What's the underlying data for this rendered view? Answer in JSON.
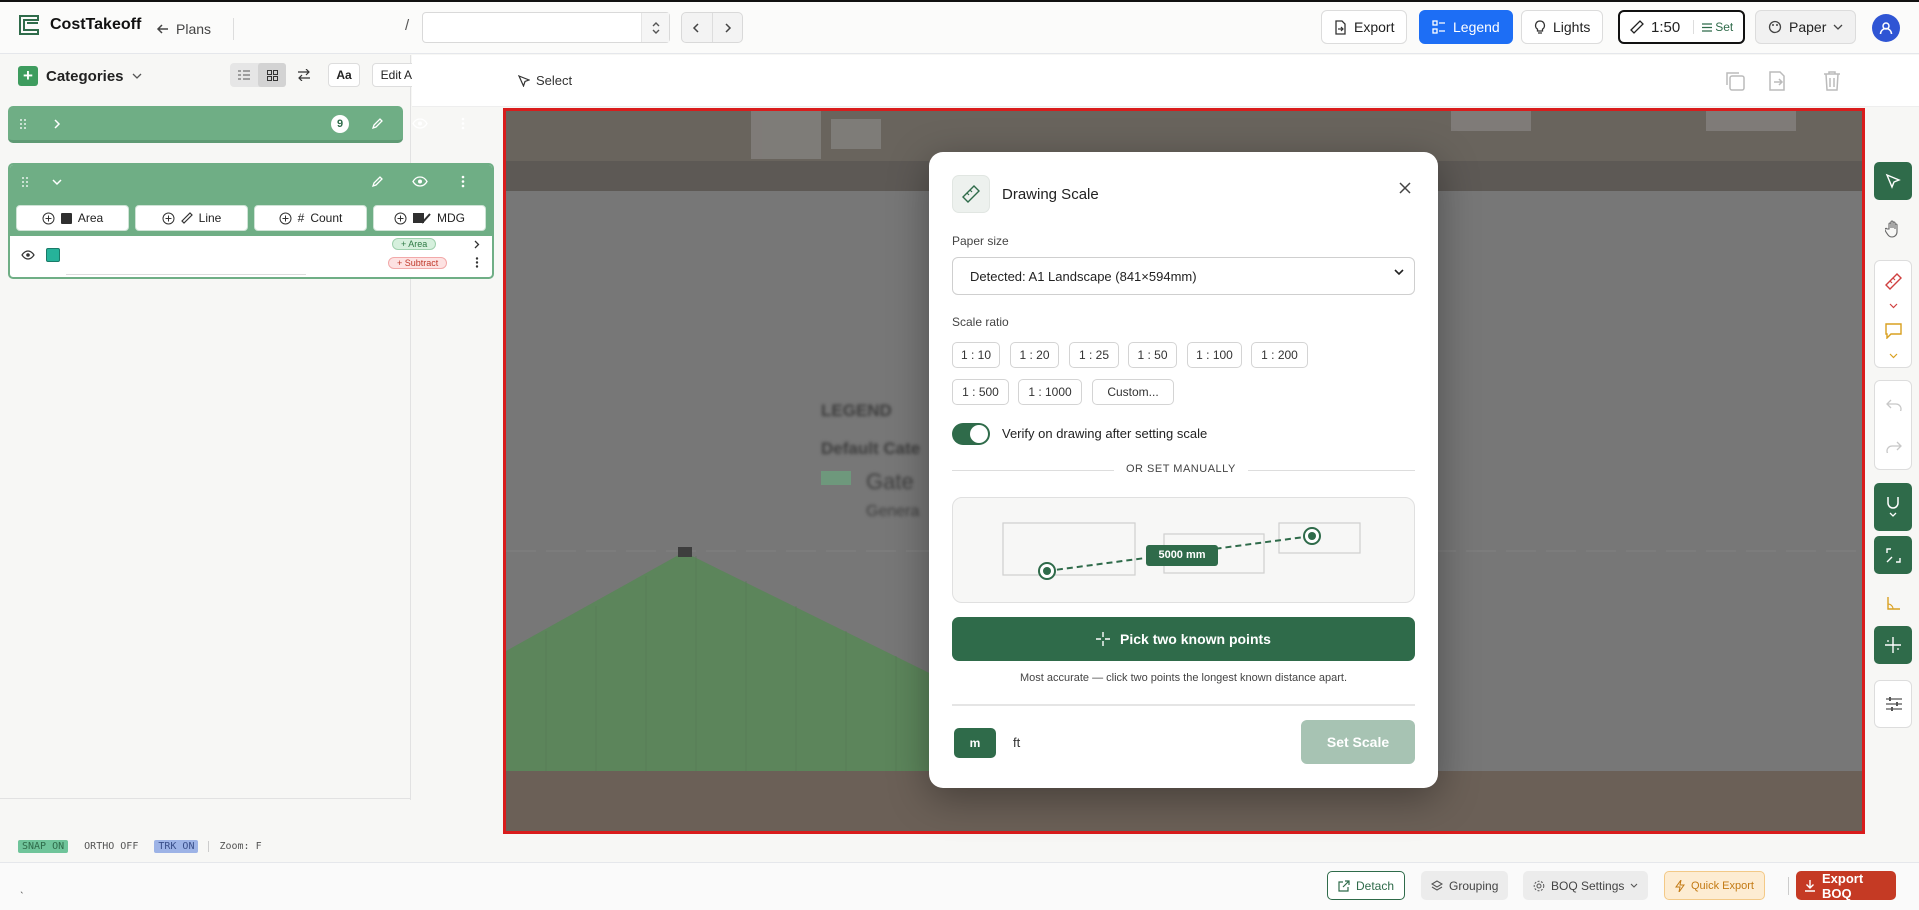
{
  "app": {
    "name": "CostTakeoff",
    "plans_label": "Plans",
    "breadcrumb_sep": "/",
    "plan_select_value": ""
  },
  "toolbar": {
    "export_label": "Export",
    "legend_label": "Legend",
    "lights_label": "Lights",
    "scale_value": "1:50",
    "scale_set_label": "Set",
    "paper_label": "Paper"
  },
  "sidebar": {
    "title": "Categories",
    "text_size_label": "Aa",
    "edit_all_label": "Edit All",
    "group_count": "9",
    "add_buttons": [
      "Area",
      "Line",
      "Count",
      "MDG"
    ],
    "item_area_pill": "+ Area",
    "item_subtract_pill": "+ Subtract"
  },
  "canvas": {
    "select_label": "Select",
    "legend_heading": "LEGEND",
    "legend_line2": "Default Cate",
    "legend_line3": "Gate",
    "legend_line4": "Genera"
  },
  "modal": {
    "title": "Drawing Scale",
    "paper_size_label": "Paper size",
    "paper_size_value": "Detected: A1 Landscape (841×594mm)",
    "scale_ratio_label": "Scale ratio",
    "ratios_row1": [
      "1 : 10",
      "1 : 20",
      "1 : 25",
      "1 : 50",
      "1 : 100",
      "1 : 200"
    ],
    "ratios_row2": [
      "1 : 500",
      "1 : 1000",
      "Custom..."
    ],
    "verify_label": "Verify on drawing after setting scale",
    "verify_on": true,
    "or_manual": "OR SET MANUALLY",
    "illus_distance": "5000 mm",
    "pick_label": "Pick two known points",
    "pick_hint": "Most accurate — click two points the longest known distance apart.",
    "unit_m": "m",
    "unit_ft": "ft",
    "set_scale_label": "Set Scale"
  },
  "status": {
    "snap": "SNAP ON",
    "ortho": "ORTHO OFF",
    "trk": "TRK ON",
    "zoom": "Zoom: F"
  },
  "bottom": {
    "cursor_text": "ˎ",
    "detach": "Detach",
    "grouping": "Grouping",
    "boq_settings": "BOQ Settings",
    "quick_export": "Quick Export",
    "export_boq": "Export BOQ"
  },
  "colors": {
    "brand_green": "#2f6b4a",
    "legend_blue": "#1d6ef5",
    "canvas_border": "#d91c1c",
    "export_boq_red": "#c53a24"
  }
}
